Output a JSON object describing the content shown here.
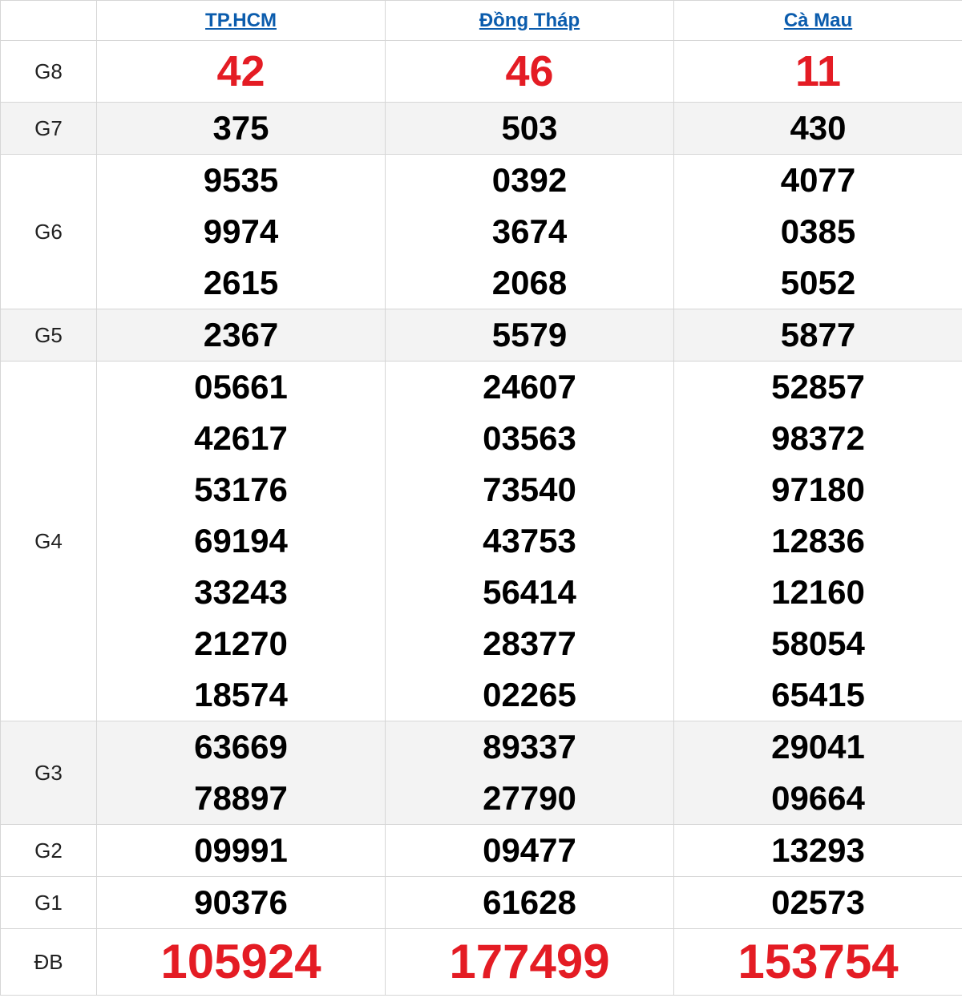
{
  "header": {
    "provinces": [
      "TP.HCM",
      "Đồng Tháp",
      "Cà Mau"
    ]
  },
  "rows": [
    {
      "label": "G8",
      "style": "red-mid",
      "shade": false,
      "values": [
        [
          "42"
        ],
        [
          "46"
        ],
        [
          "11"
        ]
      ]
    },
    {
      "label": "G7",
      "style": "normal",
      "shade": true,
      "values": [
        [
          "375"
        ],
        [
          "503"
        ],
        [
          "430"
        ]
      ]
    },
    {
      "label": "G6",
      "style": "normal",
      "shade": false,
      "values": [
        [
          "9535",
          "9974",
          "2615"
        ],
        [
          "0392",
          "3674",
          "2068"
        ],
        [
          "4077",
          "0385",
          "5052"
        ]
      ]
    },
    {
      "label": "G5",
      "style": "normal",
      "shade": true,
      "values": [
        [
          "2367"
        ],
        [
          "5579"
        ],
        [
          "5877"
        ]
      ]
    },
    {
      "label": "G4",
      "style": "normal",
      "shade": false,
      "values": [
        [
          "05661",
          "42617",
          "53176",
          "69194",
          "33243",
          "21270",
          "18574"
        ],
        [
          "24607",
          "03563",
          "73540",
          "43753",
          "56414",
          "28377",
          "02265"
        ],
        [
          "52857",
          "98372",
          "97180",
          "12836",
          "12160",
          "58054",
          "65415"
        ]
      ]
    },
    {
      "label": "G3",
      "style": "normal",
      "shade": true,
      "values": [
        [
          "63669",
          "78897"
        ],
        [
          "89337",
          "27790"
        ],
        [
          "29041",
          "09664"
        ]
      ]
    },
    {
      "label": "G2",
      "style": "normal",
      "shade": false,
      "values": [
        [
          "09991"
        ],
        [
          "09477"
        ],
        [
          "13293"
        ]
      ]
    },
    {
      "label": "G1",
      "style": "normal",
      "shade": false,
      "values": [
        [
          "90376"
        ],
        [
          "61628"
        ],
        [
          "02573"
        ]
      ]
    },
    {
      "label": "ĐB",
      "style": "red-big",
      "shade": false,
      "values": [
        [
          "105924"
        ],
        [
          "177499"
        ],
        [
          "153754"
        ]
      ]
    }
  ]
}
